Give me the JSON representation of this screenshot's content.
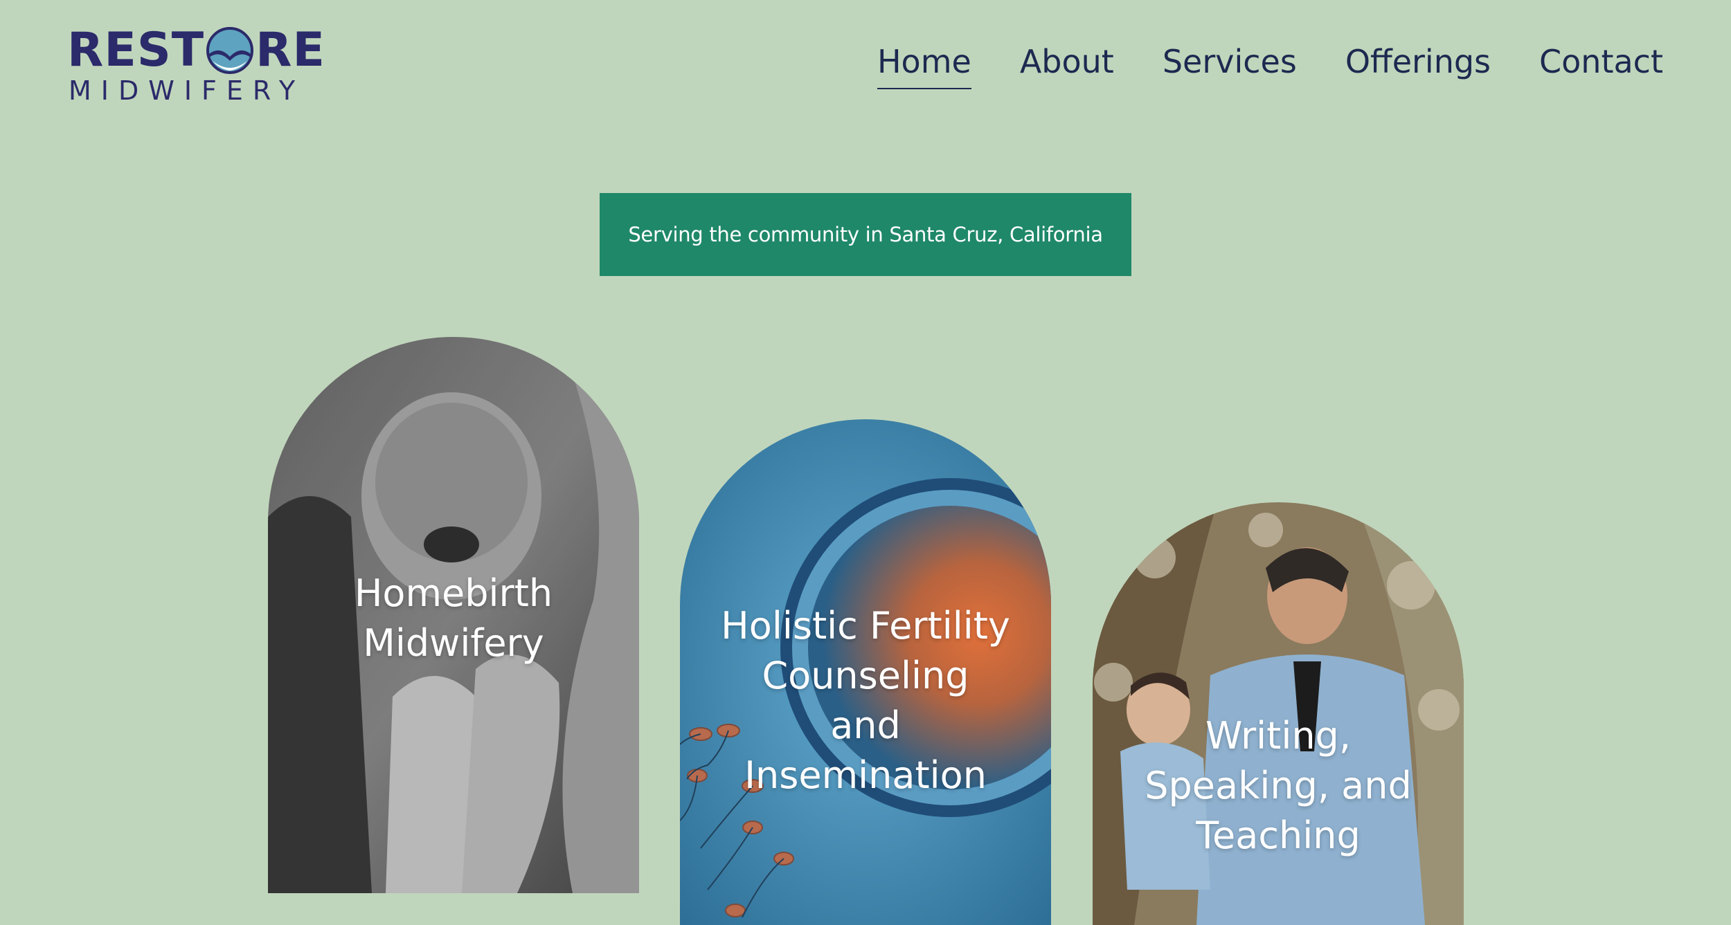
{
  "logo": {
    "word_top_left": "REST",
    "word_top_right": "RE",
    "word_bottom": "MIDWIFERY",
    "icon": "wave-globe-icon",
    "colors": {
      "text": "#2b2a6a",
      "globe": "#5ea3c0"
    }
  },
  "nav": {
    "items": [
      {
        "label": "Home",
        "active": true
      },
      {
        "label": "About",
        "active": false
      },
      {
        "label": "Services",
        "active": false
      },
      {
        "label": "Offerings",
        "active": false
      },
      {
        "label": "Contact",
        "active": false
      }
    ]
  },
  "banner": {
    "text": "Serving the community in Santa Cruz, California",
    "color": "#1f8869"
  },
  "cards": [
    {
      "label_line1": "Homebirth",
      "label_line2": "Midwifery",
      "image": "newborn-baby-photo"
    },
    {
      "label_line1": "Holistic Fertility",
      "label_line2": "Counseling",
      "label_line3": "and",
      "label_line4": "Insemination",
      "image": "egg-and-sperm-photo"
    },
    {
      "label_line1": "Writing,",
      "label_line2": "Speaking, and",
      "label_line3": "Teaching",
      "image": "midwife-holding-child-photo"
    }
  ],
  "colors": {
    "background": "#c0d6bc",
    "nav_text": "#1d2950"
  }
}
